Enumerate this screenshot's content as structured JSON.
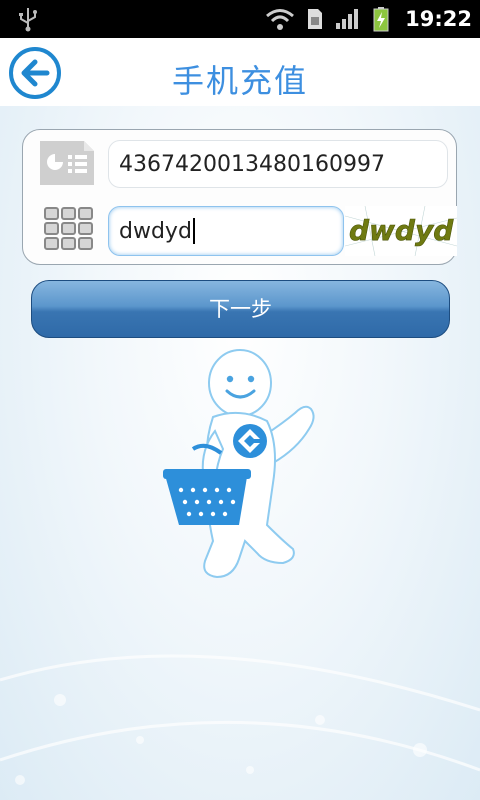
{
  "status_bar": {
    "time": "19:22",
    "icons": [
      "usb-icon",
      "wifi-icon",
      "sim-icon",
      "signal-icon",
      "battery-charging-icon"
    ]
  },
  "header": {
    "title": "手机充值",
    "back_icon": "arrow-left-icon"
  },
  "form": {
    "phone_icon": "contact-card-icon",
    "phone_value": "4367420013480160997",
    "captcha_icon": "keypad-icon",
    "captcha_value": "dwdyd",
    "captcha_image_text": "dwdyd"
  },
  "next_button": {
    "label": "下一步"
  },
  "colors": {
    "accent": "#3d8fe0",
    "button": "#3975b2",
    "status_bar": "#000000"
  }
}
